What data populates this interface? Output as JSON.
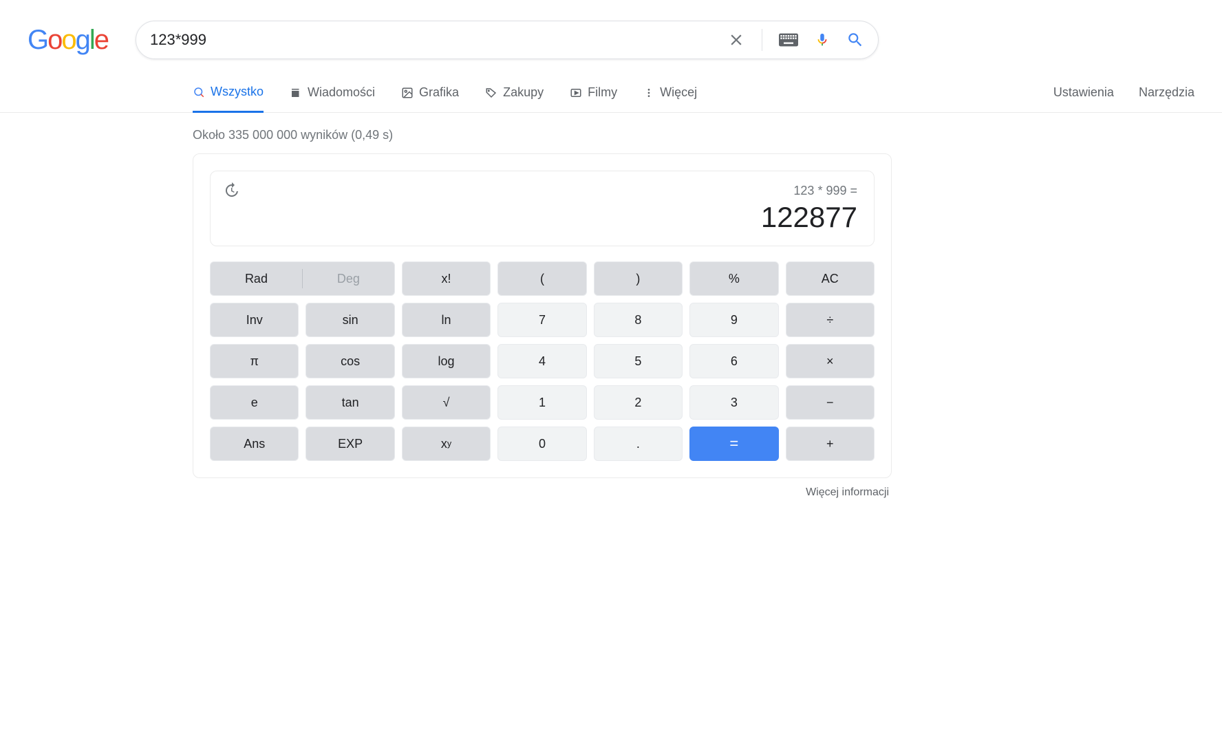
{
  "search": {
    "query": "123*999"
  },
  "tabs": {
    "all": "Wszystko",
    "news": "Wiadomości",
    "images": "Grafika",
    "shopping": "Zakupy",
    "videos": "Filmy",
    "more": "Więcej",
    "settings": "Ustawienia",
    "tools": "Narzędzia"
  },
  "results_meta": "Około 335 000 000 wyników (0,49 s)",
  "calc": {
    "expression": "123 * 999 =",
    "result": "122877",
    "buttons": {
      "rad": "Rad",
      "deg": "Deg",
      "fact": "x!",
      "lparen": "(",
      "rparen": ")",
      "percent": "%",
      "ac": "AC",
      "inv": "Inv",
      "sin": "sin",
      "ln": "ln",
      "n7": "7",
      "n8": "8",
      "n9": "9",
      "div": "÷",
      "pi": "π",
      "cos": "cos",
      "log": "log",
      "n4": "4",
      "n5": "5",
      "n6": "6",
      "mul": "×",
      "e": "e",
      "tan": "tan",
      "sqrt": "√",
      "n1": "1",
      "n2": "2",
      "n3": "3",
      "sub": "−",
      "ans": "Ans",
      "exp": "EXP",
      "n0": "0",
      "dot": ".",
      "eq": "=",
      "add": "+"
    }
  },
  "more_info": "Więcej informacji"
}
